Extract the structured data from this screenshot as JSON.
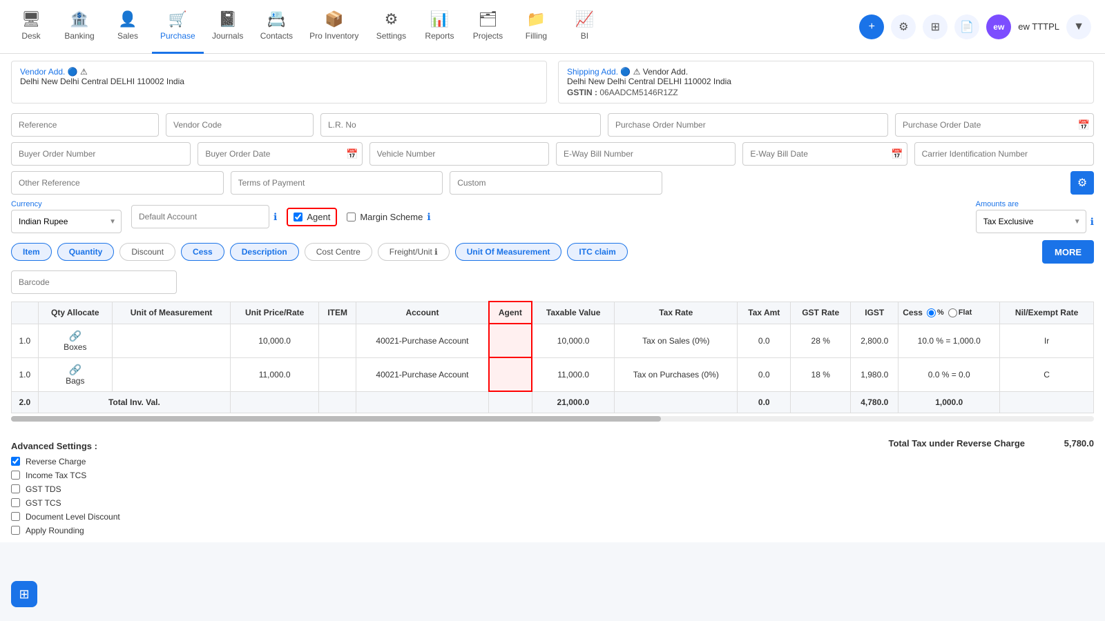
{
  "nav": {
    "items": [
      {
        "id": "desk",
        "label": "Desk",
        "icon": "🖥",
        "active": false
      },
      {
        "id": "banking",
        "label": "Banking",
        "icon": "🏦",
        "active": false
      },
      {
        "id": "sales",
        "label": "Sales",
        "icon": "👤",
        "active": false
      },
      {
        "id": "purchase",
        "label": "Purchase",
        "icon": "🛒",
        "active": true
      },
      {
        "id": "journals",
        "label": "Journals",
        "icon": "📓",
        "active": false
      },
      {
        "id": "contacts",
        "label": "Contacts",
        "icon": "📇",
        "active": false
      },
      {
        "id": "pro_inventory",
        "label": "Pro Inventory",
        "icon": "📦",
        "active": false
      },
      {
        "id": "settings",
        "label": "Settings",
        "icon": "⚙",
        "active": false
      },
      {
        "id": "reports",
        "label": "Reports",
        "icon": "📊",
        "active": false
      },
      {
        "id": "projects",
        "label": "Projects",
        "icon": "🗂",
        "active": false
      },
      {
        "id": "filling",
        "label": "Filling",
        "icon": "📁",
        "active": false
      },
      {
        "id": "bi",
        "label": "BI",
        "icon": "📈",
        "active": false
      }
    ],
    "user_label": "ew TTTPL"
  },
  "address": {
    "vendor_label": "Vendor Add.",
    "vendor_address": "Delhi New Delhi Central DELHI 110002 India",
    "shipping_label": "Shipping Add.",
    "shipping_address": "Delhi New Delhi Central DELHI 110002 India",
    "shipping_gstin_label": "GSTIN :",
    "shipping_gstin": "06AADCM5146R1ZZ"
  },
  "form": {
    "reference_placeholder": "Reference",
    "vendor_code_placeholder": "Vendor Code",
    "lr_no_placeholder": "L.R. No",
    "purchase_order_number_placeholder": "Purchase Order Number",
    "purchase_order_date_placeholder": "Purchase Order Date",
    "buyer_order_number_placeholder": "Buyer Order Number",
    "buyer_order_date_placeholder": "Buyer Order Date",
    "vehicle_number_placeholder": "Vehicle Number",
    "eway_bill_number_placeholder": "E-Way Bill Number",
    "eway_bill_date_placeholder": "E-Way Bill Date",
    "carrier_id_number_placeholder": "Carrier Identification Number",
    "other_reference_placeholder": "Other Reference",
    "terms_of_payment_placeholder": "Terms of Payment",
    "custom_placeholder": "Custom"
  },
  "currency": {
    "label": "Currency",
    "value": "Indian Rupee",
    "default_account_placeholder": "Default Account",
    "agent_label": "Agent",
    "agent_checked": true,
    "margin_scheme_label": "Margin Scheme",
    "margin_scheme_checked": false,
    "amounts_label": "Amounts are",
    "amounts_value": "Tax Exclusive"
  },
  "columns": {
    "toggles": [
      {
        "id": "item",
        "label": "Item",
        "active": true
      },
      {
        "id": "quantity",
        "label": "Quantity",
        "active": true
      },
      {
        "id": "discount",
        "label": "Discount",
        "active": false
      },
      {
        "id": "cess",
        "label": "Cess",
        "active": true
      },
      {
        "id": "description",
        "label": "Description",
        "active": true
      },
      {
        "id": "cost_centre",
        "label": "Cost Centre",
        "active": false
      },
      {
        "id": "freight_unit",
        "label": "Freight/Unit",
        "active": false
      },
      {
        "id": "unit_of_measurement",
        "label": "Unit Of Measurement",
        "active": true
      },
      {
        "id": "itc_claim",
        "label": "ITC claim",
        "active": true
      }
    ],
    "more_label": "MORE"
  },
  "barcode": {
    "placeholder": "Barcode"
  },
  "table": {
    "headers": [
      "",
      "Qty Allocate",
      "Unit of Measurement",
      "Unit Price/Rate",
      "ITEM",
      "Account",
      "Agent",
      "Taxable Value",
      "Tax Rate",
      "Tax Amt",
      "GST Rate",
      "IGST",
      "Cess",
      "Nil/Exempt Rate"
    ],
    "cess_options": [
      "%",
      "Flat"
    ],
    "rows": [
      {
        "seq": "1.0",
        "link_icon": "🔗",
        "qty_allocate": "Boxes",
        "unit_price_rate": "10,000.0",
        "item": "",
        "account": "40021-Purchase Account",
        "agent": "",
        "taxable_value": "10,000.0",
        "tax_rate": "Tax on Sales (0%)",
        "tax_amt": "0.0",
        "gst_rate": "28 %",
        "igst": "2,800.0",
        "cess": "10.0 % = 1,000.0",
        "nil_exempt_rate": "Ir"
      },
      {
        "seq": "1.0",
        "link_icon": "🔗",
        "qty_allocate": "Bags",
        "unit_price_rate": "11,000.0",
        "item": "",
        "account": "40021-Purchase Account",
        "agent": "",
        "taxable_value": "11,000.0",
        "tax_rate": "Tax on Purchases (0%)",
        "tax_amt": "0.0",
        "gst_rate": "18 %",
        "igst": "1,980.0",
        "cess": "0.0 % = 0.0",
        "nil_exempt_rate": "C"
      }
    ],
    "total_row": {
      "seq": "2.0",
      "label": "Total Inv. Val.",
      "taxable_value": "21,000.0",
      "tax_amt": "0.0",
      "igst": "4,780.0",
      "cess": "1,000.0"
    }
  },
  "advanced_settings": {
    "title": "Advanced Settings :",
    "items": [
      {
        "id": "reverse_charge",
        "label": "Reverse Charge",
        "checked": true
      },
      {
        "id": "income_tax_tcs",
        "label": "Income Tax TCS",
        "checked": false
      },
      {
        "id": "gst_tds",
        "label": "GST TDS",
        "checked": false
      },
      {
        "id": "gst_tcs",
        "label": "GST TCS",
        "checked": false
      },
      {
        "id": "document_level_discount",
        "label": "Document Level Discount",
        "checked": false
      },
      {
        "id": "apply_rounding",
        "label": "Apply Rounding",
        "checked": false
      }
    ]
  },
  "totals": {
    "total_tax_reverse_charge_label": "Total Tax under Reverse Charge",
    "total_tax_reverse_charge_value": "5,780.0"
  }
}
